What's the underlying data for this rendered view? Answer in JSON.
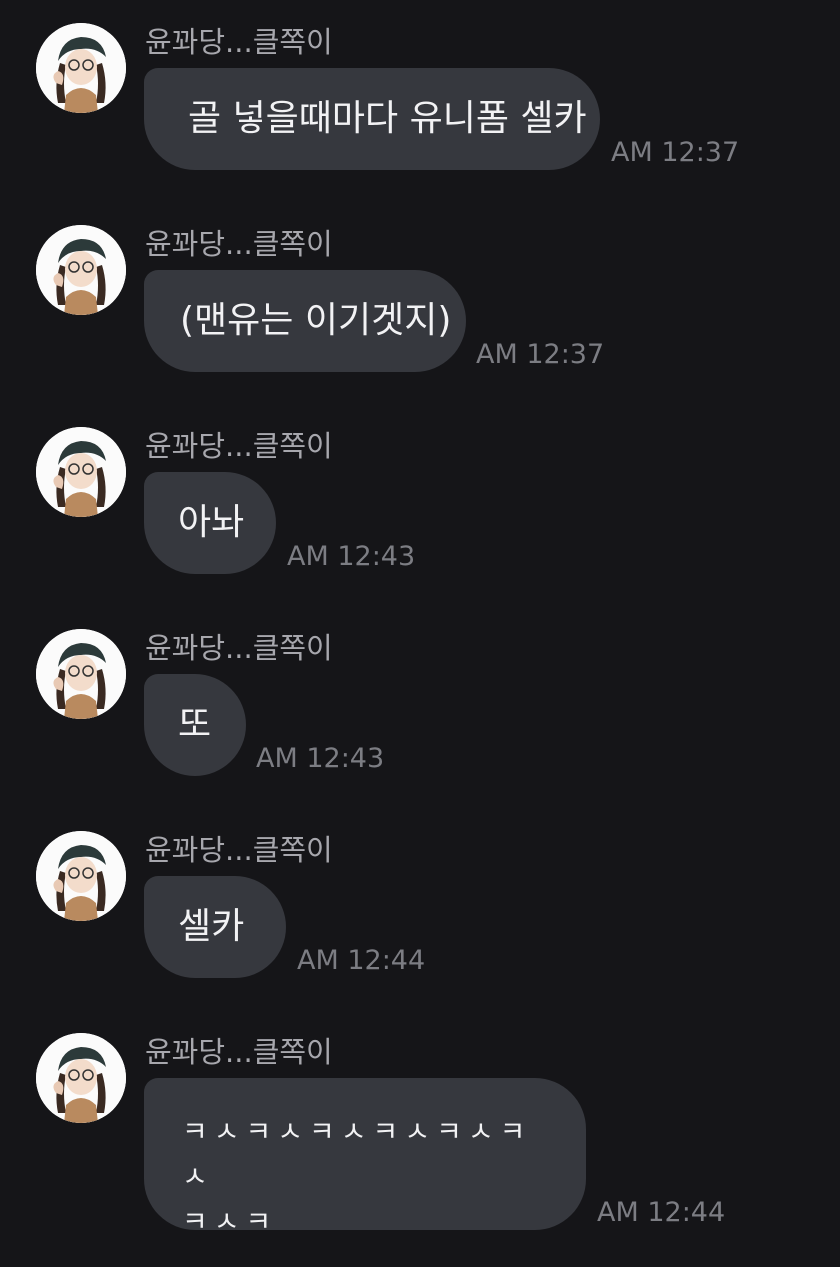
{
  "sender_name": "윤꽈당...클쪽이",
  "messages": [
    {
      "text": "골 넣을때마다 유니폼 셀카",
      "time": "AM 12:37"
    },
    {
      "text": "(맨유는 이기겟지)",
      "time": "AM 12:37"
    },
    {
      "text": "아놔",
      "time": "AM 12:43"
    },
    {
      "text": "또",
      "time": "AM 12:43"
    },
    {
      "text": "셀카",
      "time": "AM 12:44"
    },
    {
      "text_line1": "ㅋㅅㅋㅅㅋㅅㅋㅅㅋㅅㅋㅅ",
      "text_line2": "ㅋㅅㅋ",
      "time": "AM 12:44"
    }
  ],
  "colors": {
    "background": "#151518",
    "bubble": "#36383e",
    "name_text": "#a7a7ad",
    "time_text": "#7c7d83",
    "message_text": "#f2f2f4"
  },
  "icons": {
    "avatar": "profile-photo"
  }
}
